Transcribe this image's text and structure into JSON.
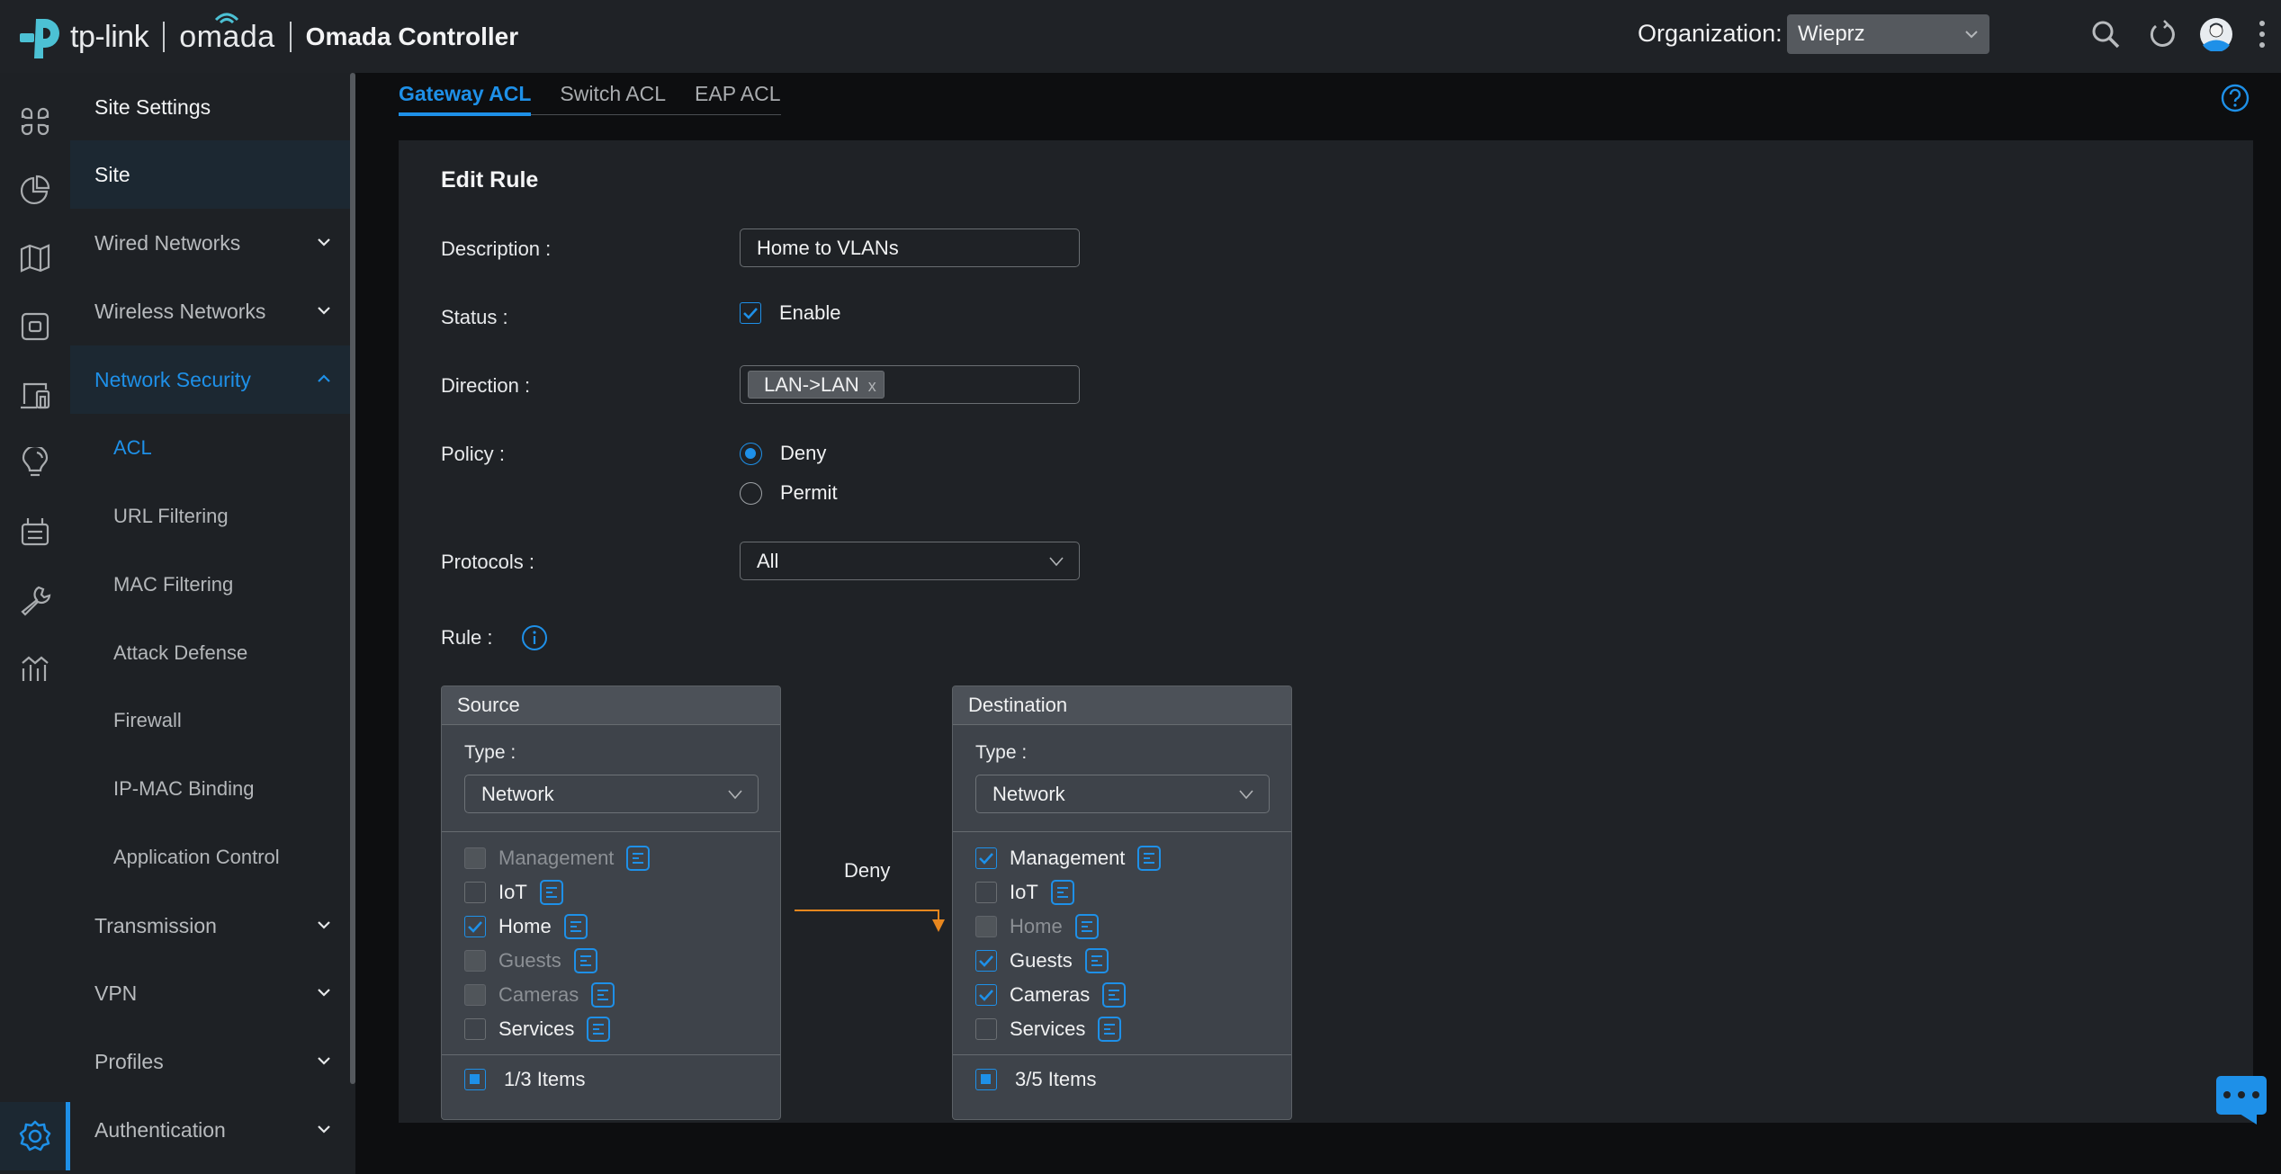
{
  "header": {
    "brand": "tp-link",
    "product": "omada",
    "app_title": "Omada Controller",
    "org_label": "Organization:",
    "org_value": "Wieprz",
    "icons": [
      "search-icon",
      "refresh-icon",
      "avatar",
      "more-vertical-icon"
    ]
  },
  "rail": {
    "icons": [
      "dashboard-icon",
      "statistics-icon",
      "map-icon",
      "devices-icon",
      "clients-icon",
      "insights-icon",
      "logs-icon",
      "tools-icon",
      "reports-icon",
      "settings-icon"
    ],
    "active": "settings-icon"
  },
  "sidebar": {
    "title": "Site Settings",
    "items": [
      {
        "label": "Site",
        "type": "top",
        "state": "highlight"
      },
      {
        "label": "Wired Networks",
        "type": "group",
        "expanded": false
      },
      {
        "label": "Wireless Networks",
        "type": "group",
        "expanded": false
      },
      {
        "label": "Network Security",
        "type": "group",
        "expanded": true,
        "state": "active"
      },
      {
        "label": "ACL",
        "type": "sub",
        "state": "active"
      },
      {
        "label": "URL Filtering",
        "type": "sub"
      },
      {
        "label": "MAC Filtering",
        "type": "sub"
      },
      {
        "label": "Attack Defense",
        "type": "sub"
      },
      {
        "label": "Firewall",
        "type": "sub"
      },
      {
        "label": "IP-MAC Binding",
        "type": "sub"
      },
      {
        "label": "Application Control",
        "type": "sub"
      },
      {
        "label": "Transmission",
        "type": "group",
        "expanded": false
      },
      {
        "label": "VPN",
        "type": "group",
        "expanded": false
      },
      {
        "label": "Profiles",
        "type": "group",
        "expanded": false
      },
      {
        "label": "Authentication",
        "type": "group",
        "expanded": false
      }
    ]
  },
  "tabs": [
    {
      "label": "Gateway ACL",
      "active": true
    },
    {
      "label": "Switch ACL",
      "active": false
    },
    {
      "label": "EAP ACL",
      "active": false
    }
  ],
  "form": {
    "title": "Edit Rule",
    "description_label": "Description",
    "description_value": "Home to VLANs",
    "status_label": "Status",
    "status_option": "Enable",
    "status_checked": true,
    "direction_label": "Direction",
    "direction_tag": "LAN->LAN",
    "direction_tag_remove": "x",
    "policy_label": "Policy",
    "policy_options": [
      {
        "label": "Deny",
        "selected": true
      },
      {
        "label": "Permit",
        "selected": false
      }
    ],
    "protocols_label": "Protocols",
    "protocols_value": "All",
    "rule_label": "Rule",
    "colon": ":"
  },
  "rule": {
    "arrow_label": "Deny",
    "arrow_color": "#e8871e",
    "source": {
      "title": "Source",
      "type_label": "Type",
      "type_value": "Network",
      "options": [
        {
          "label": "Management",
          "checked": false,
          "disabled": true
        },
        {
          "label": "IoT",
          "checked": false,
          "disabled": false
        },
        {
          "label": "Home",
          "checked": true,
          "disabled": false
        },
        {
          "label": "Guests",
          "checked": false,
          "disabled": true
        },
        {
          "label": "Cameras",
          "checked": false,
          "disabled": true
        },
        {
          "label": "Services",
          "checked": false,
          "disabled": false
        }
      ],
      "footer": "1/3 Items"
    },
    "destination": {
      "title": "Destination",
      "type_label": "Type",
      "type_value": "Network",
      "options": [
        {
          "label": "Management",
          "checked": true,
          "disabled": false
        },
        {
          "label": "IoT",
          "checked": false,
          "disabled": false
        },
        {
          "label": "Home",
          "checked": false,
          "disabled": true
        },
        {
          "label": "Guests",
          "checked": true,
          "disabled": false
        },
        {
          "label": "Cameras",
          "checked": true,
          "disabled": false
        },
        {
          "label": "Services",
          "checked": false,
          "disabled": false
        }
      ],
      "footer": "3/5 Items"
    }
  },
  "colors": {
    "accent": "#1e90e8",
    "brand_teal": "#4cc1d4",
    "header_bg": "#1f2226",
    "card_bg": "#1f2226",
    "page_bg": "#0d0e10"
  }
}
